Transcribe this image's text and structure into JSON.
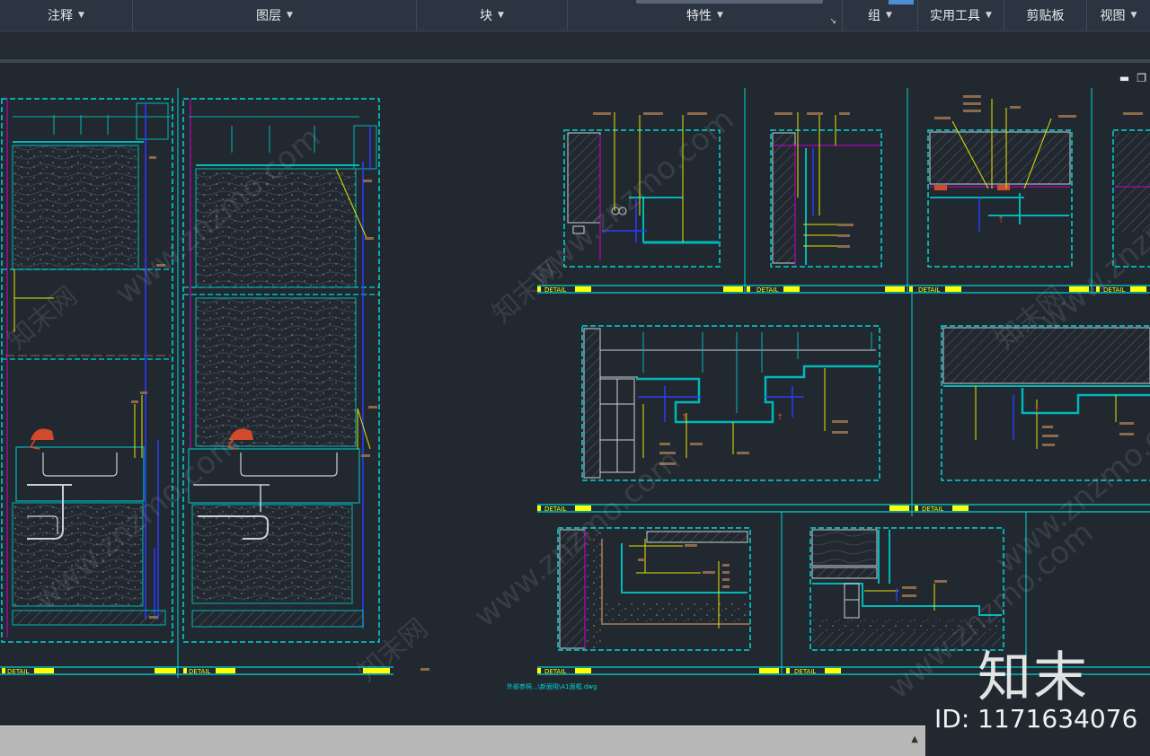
{
  "ribbon": {
    "panels": [
      {
        "label": "注释",
        "dropdown": true
      },
      {
        "label": "图层",
        "dropdown": true
      },
      {
        "label": "块",
        "dropdown": true
      },
      {
        "label": "特性",
        "dropdown": true
      },
      {
        "label": "组",
        "dropdown": true
      },
      {
        "label": "实用工具",
        "dropdown": true
      },
      {
        "label": "剪贴板",
        "dropdown": false
      },
      {
        "label": "视图",
        "dropdown": true
      }
    ],
    "expand_icon": "dialog-launcher-icon"
  },
  "drawing": {
    "detail_label": "DETAIL",
    "xref_path": "外部参照...\\新面阻\\A1面框.dwg",
    "watermark_text": "www.znzmo.com",
    "watermark_cn": "知末网"
  },
  "brand": {
    "logo_text": "知末",
    "id_text": "ID: 1171634076"
  },
  "colors": {
    "background": "#212830",
    "frame_cyan": "#00d6d6",
    "detail_yellow": "#ffff00",
    "leader_yellow": "#e6e600",
    "dim_blue": "#2a3cff",
    "magenta": "#d000d0",
    "brown_text": "#8a6a4a",
    "fixture_red": "#d24a2a"
  },
  "window_controls": {
    "minimize": "minimize-icon",
    "restore": "restore-icon"
  }
}
